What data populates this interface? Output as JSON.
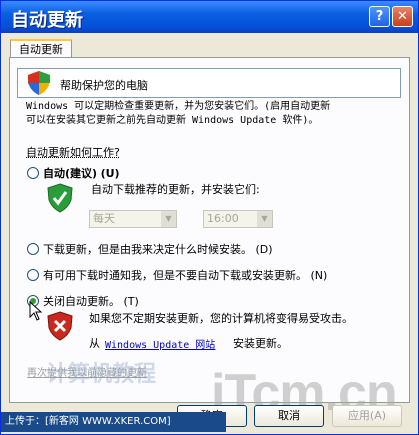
{
  "window": {
    "title": "自动更新",
    "help_glyph": "?",
    "close_glyph": "✕"
  },
  "tab": {
    "label": "自动更新"
  },
  "banner": {
    "text": "帮助保护您的电脑"
  },
  "description": {
    "line1": "Windows 可以定期检查重要更新，并为您安装它们。(启用自动更新",
    "line2": "可以在安装其它更新之前先自动更新 Windows Update 软件)。"
  },
  "section_label": "自动更新如何工作?",
  "options": {
    "auto": {
      "label_bold": "自动(建议)",
      "shortcut": "(U)",
      "sub": "自动下载推荐的更新，并安装它们:"
    },
    "download": {
      "label": "下载更新，但是由我来决定什么时候安装。",
      "shortcut": "(D)"
    },
    "notify": {
      "label": "有可用下载时通知我，但是不要自动下载或安装更新。",
      "shortcut": "(N)"
    },
    "off": {
      "label": "关闭自动更新。",
      "shortcut": "(T)",
      "warning": "如果您不定期安装更新，您的计算机将变得易受攻击。"
    },
    "selected": "off"
  },
  "schedule": {
    "day": "每天",
    "time": "16:00"
  },
  "link": {
    "prefix": "从",
    "link_text": "Windows Update 网站",
    "suffix": "安装更新。"
  },
  "hidden_updates_link": "再次提供我以前隐藏的更新",
  "buttons": {
    "ok": "确定",
    "cancel": "取消",
    "apply": "应用(A)"
  },
  "footer": {
    "text": "上传于：[新客网 WWW.XKER.COM]"
  },
  "watermark": {
    "main": "iTcm.cn",
    "small": "计算机教程"
  },
  "colors": {
    "titlebar": "#0a5fe0",
    "accent": "#ffc73c",
    "link": "#0000cc"
  }
}
